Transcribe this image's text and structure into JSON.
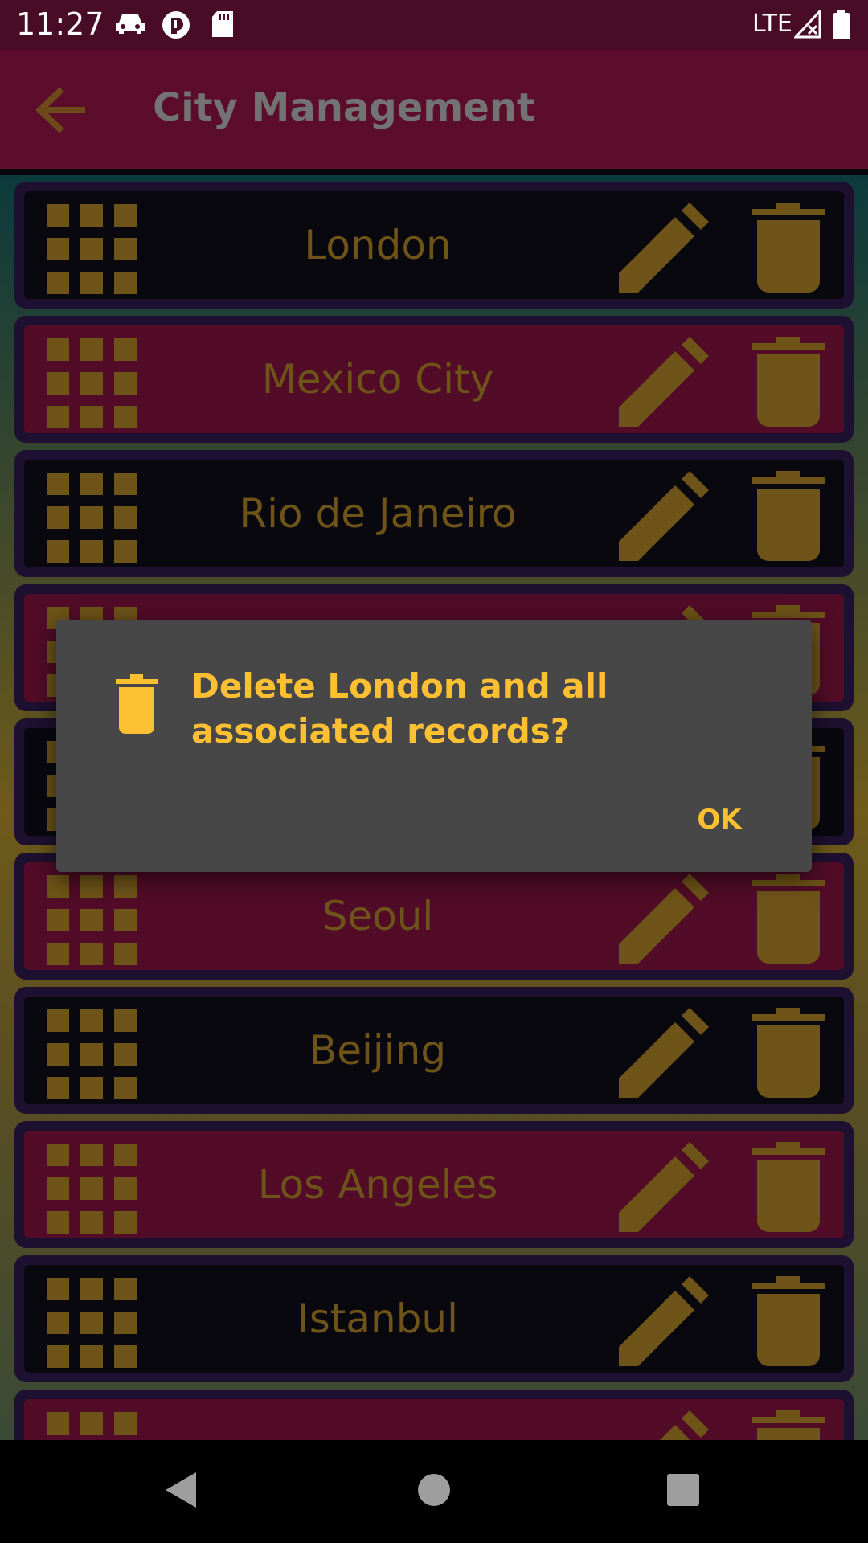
{
  "status_bar": {
    "time": "11:27",
    "network": "LTE",
    "icons": [
      "car-icon",
      "pocket-icon",
      "sd-card-icon",
      "signal-icon",
      "battery-icon"
    ]
  },
  "app_bar": {
    "back_icon": "arrow-back-icon",
    "title": "City Management"
  },
  "cities": [
    {
      "name": "London",
      "style": "dark"
    },
    {
      "name": "Mexico City",
      "style": "red"
    },
    {
      "name": "Rio de Janeiro",
      "style": "dark"
    },
    {
      "name": "",
      "style": "red"
    },
    {
      "name": "",
      "style": "dark"
    },
    {
      "name": "Seoul",
      "style": "red"
    },
    {
      "name": "Beijing",
      "style": "dark"
    },
    {
      "name": "Los Angeles",
      "style": "red"
    },
    {
      "name": "Istanbul",
      "style": "dark"
    },
    {
      "name": "",
      "style": "red"
    }
  ],
  "row_icons": {
    "drag": "grid-icon",
    "edit": "pencil-icon",
    "delete": "trash-icon"
  },
  "dialog": {
    "icon": "trash-icon",
    "message": "Delete London and all associated records?",
    "ok_label": "OK"
  },
  "colors": {
    "accent": "#FDC033",
    "muted_accent": "#6E5418",
    "app_bar": "#5B0D2B",
    "status_bar": "#480C26",
    "row_dark": "#09080F",
    "row_red": "#520C27",
    "dialog": "#474747"
  },
  "nav_bar": {
    "icons": [
      "back-triangle-icon",
      "home-circle-icon",
      "recents-square-icon"
    ]
  }
}
